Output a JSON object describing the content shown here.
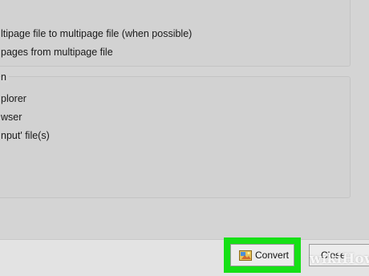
{
  "options": {
    "multipage_convert_label": "ltipage file to multipage file (when possible)",
    "extract_pages_label": "pages from multipage file"
  },
  "after_conversion": {
    "group_title": "n",
    "explorer_label": "plorer",
    "browser_label": "wser",
    "input_files_label": "nput' file(s)"
  },
  "footer": {
    "convert_label": "Convert",
    "close_label": "Close"
  },
  "watermark": {
    "wiki": "wiki",
    "how": "How"
  },
  "colors": {
    "highlight": "#16e016",
    "panel": "#d4d4d4"
  }
}
